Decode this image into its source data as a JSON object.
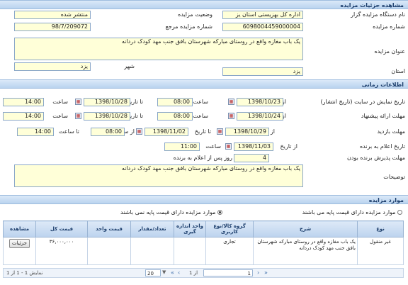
{
  "header": {
    "title": "مشاهده جزئیات مزایده"
  },
  "details": {
    "organizer_label": "نام دستگاه مزایده گزار",
    "organizer_value": "اداره کل بهزیستی استان یز",
    "status_label": "وضعیت مزایده",
    "status_value": "منتشر شده",
    "number_label": "شماره مزایده",
    "number_value": "6098004459000004",
    "ref_label": "شماره مزایده مرجع",
    "ref_value": "98/7/209072",
    "subject_label": "عنوان مزایده",
    "subject_value": "یک باب مغازه واقع در روستای مبارکه شهرستان بافق جنب مهد کودک دردانه",
    "province_label": "استان",
    "province_value": "یزد",
    "city_label": "شهر",
    "city_value": "یزد"
  },
  "timing": {
    "title": "اطلاعات زمانی",
    "publish_label": "تاریخ نمایش در سایت (تاریخ انتشار)",
    "offer_label": "مهلت ارائه پیشنهاد",
    "visit_label": "مهلت بازدید",
    "announce_label": "تاریخ اعلام به برنده",
    "accept_label": "مهلت پذیرش برنده بودن",
    "from_date": "از تاریخ",
    "to_date": "تا تاریخ",
    "time": "ساعت",
    "from_time": "از ساعت",
    "to_time": "تا ساعت",
    "publish_from": "1398/10/23",
    "publish_from_time": "08:00",
    "publish_to": "1398/10/28",
    "publish_to_time": "14:00",
    "offer_from": "1398/10/24",
    "offer_from_time": "08:00",
    "offer_to": "1398/10/28",
    "offer_to_time": "14:00",
    "visit_from": "1398/10/29",
    "visit_from_time": "08:00",
    "visit_to": "1398/11/02",
    "visit_to_time": "14:00",
    "announce_date": "1398/11/03",
    "announce_time": "11:00",
    "accept_days": "4",
    "accept_suffix": "روز پس از اعلام به برنده",
    "notes_label": "توضیحات",
    "notes_value": "یک باب مغازه واقع در روستای مبارکه شهرستان بافق جنب مهد کودک دردانه"
  },
  "items": {
    "title": "موارد مزایده",
    "radio_with": "موارد مزایده دارای قیمت پایه می باشند",
    "radio_without": "موارد مزایده دارای قیمت پایه نمی باشند",
    "columns": [
      "نوع",
      "شرح",
      "گروه کالا/نوع کاربری",
      "واحد اندازه گیری",
      "تعداد/مقدار",
      "قیمت واحد",
      "قیمت کل",
      "مشاهده"
    ],
    "rows": [
      {
        "type": "غیر منقول",
        "desc": "یک باب مغازه واقع در روستای مبارکه شهرستان بافق جنب مهد کودک دردانه",
        "group": "تجاری",
        "unit": "",
        "qty": "",
        "unit_price": "",
        "total": "۳۶,۰۰۰,۰۰۰",
        "view": "جزئیات"
      }
    ]
  },
  "pager": {
    "page": "1",
    "of": "از 1",
    "size": "20",
    "summary": "نمایش 1 - 1 از 1"
  },
  "colors": {
    "accent": "#1b3d6b",
    "field": "#ffffd8",
    "header": "#c8dcf2"
  }
}
